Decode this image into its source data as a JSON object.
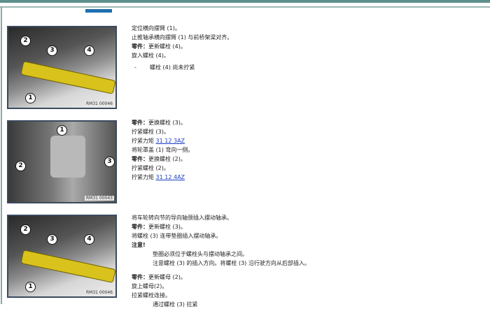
{
  "figures": [
    {
      "caption": "RM31 00046",
      "callouts": [
        "1",
        "2",
        "3",
        "4"
      ]
    },
    {
      "caption": "RM31 00043",
      "callouts": [
        "1",
        "2",
        "3"
      ]
    },
    {
      "caption": "RM31 00046",
      "callouts": [
        "1",
        "2",
        "3",
        "4"
      ]
    }
  ],
  "step1": {
    "l1": "定位横向摆臂 (1)。",
    "l2": "止推轴承横向摆臂 (1) 与前桥架梁对齐。",
    "l3_bold": "零件：",
    "l3": "更新螺栓 (4)。",
    "l4": "旋入螺栓 (4)。",
    "bullet_dash": "-",
    "bullet": "螺栓 (4) 尚未拧紧"
  },
  "step2": {
    "l1_bold": "零件：",
    "l1": "更换螺栓 (3)。",
    "l2": "拧紧螺栓 (3)。",
    "l3": "拧紧力矩 ",
    "l3_link": "31 12 3AZ",
    "l4": "将轮罩盖 (1) 弯向一侧。",
    "l5_bold": "零件：",
    "l5": "更换螺栓 (2)。",
    "l6": "拧紧螺栓 (2)。",
    "l7": "拧紧力矩 ",
    "l7_link": "31 12 4AZ"
  },
  "step3": {
    "l1": "将车轮转向节的导向轴颈插入摆动轴承。",
    "l2_bold": "零件：",
    "l2": "更新螺栓 (3)。",
    "l3": "将螺栓 (3) 连带垫圈插入摆动轴承。",
    "note": "注意!",
    "n1": "垫圈必须位于螺栓头与摆动轴承之间。",
    "n2": "注意螺栓 (3) 的插入方向。将螺栓 (3) 沿行驶方向从后部插入。",
    "l4_bold": "零件：",
    "l4": "更新螺母 (2)。",
    "l5": "旋上螺母(2)。",
    "l6": "拉紧螺栓连接。",
    "l7": "通过螺栓 (3) 拉紧"
  }
}
